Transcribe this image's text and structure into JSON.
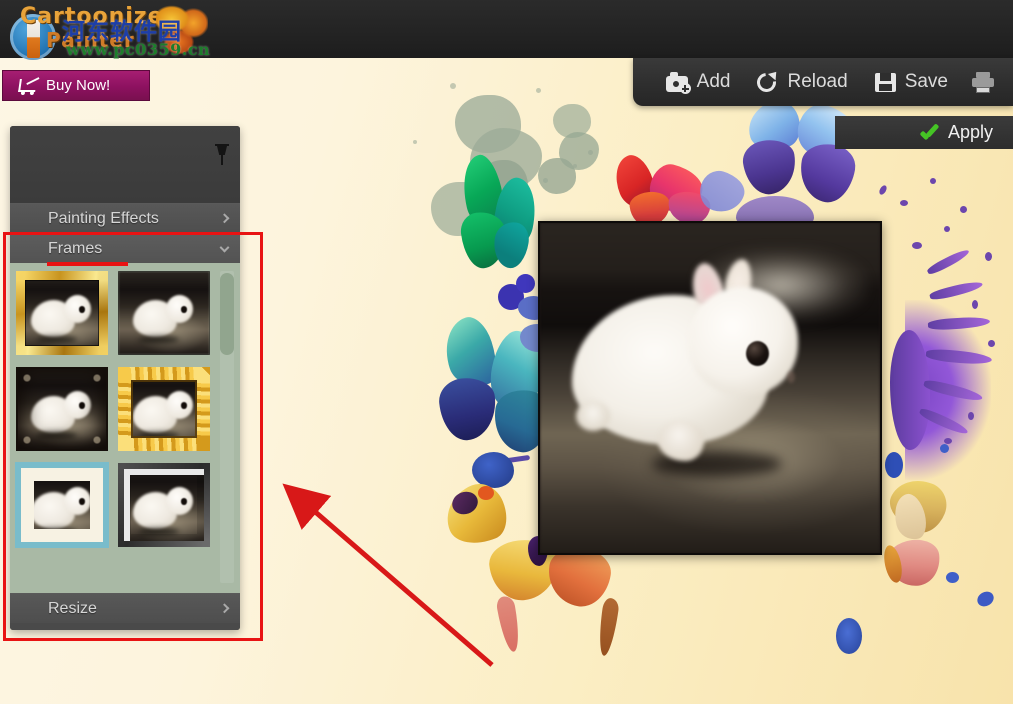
{
  "app": {
    "logo_top": "Cartoonize",
    "logo_bottom": "Painter",
    "watermark_text": "河东软件园",
    "watermark_url": "www.pc0359.cn",
    "accent_buy": "#8d1160",
    "accent_apply_check": "#45c425",
    "annotation_color": "#e81313",
    "canvas_background": "#faf0d2"
  },
  "buy": {
    "label": "Buy Now!",
    "icon": "shopping-cart-icon"
  },
  "toolbar": {
    "items": [
      {
        "label": "Add",
        "icon": "camera-add-icon"
      },
      {
        "label": "Reload",
        "icon": "circular-arrow-icon"
      },
      {
        "label": "Save",
        "icon": "floppy-disk-icon"
      },
      {
        "label": "",
        "icon": "printer-icon"
      }
    ]
  },
  "apply": {
    "label": "Apply",
    "icon": "green-check-icon"
  },
  "panel": {
    "pin_icon": "pushpin-icon",
    "sections": [
      {
        "label": "Painting Effects",
        "expanded": false,
        "chevron": "chevron-right-icon"
      },
      {
        "label": "Frames",
        "expanded": true,
        "chevron": "chevron-down-icon"
      },
      {
        "label": "Resize",
        "expanded": false,
        "chevron": "chevron-right-icon"
      }
    ],
    "frames": [
      {
        "name": "gold-bevel-frame",
        "style": "fr-gold",
        "selected": false
      },
      {
        "name": "no-frame",
        "style": "fr-plain",
        "selected": false
      },
      {
        "name": "ornate-vignette-frame",
        "style": "fr-orn",
        "selected": false
      },
      {
        "name": "baroque-gold-frame",
        "style": "fr-baroque",
        "selected": false
      },
      {
        "name": "teal-mat-frame",
        "style": "fr-mat",
        "selected": true
      },
      {
        "name": "grey-shadowbox-frame",
        "style": "fr-shadowbox",
        "selected": false
      }
    ]
  },
  "photo": {
    "subject": "white-baby-bunny-photo",
    "frame_border": "#0d0b0a"
  },
  "artwork": {
    "description": "watercolor butterflies and paint splatters on cream background",
    "butterflies": [
      "green",
      "red-pink",
      "blue-violet",
      "teal-blue",
      "yellow-orange",
      "peach-yellow"
    ],
    "splatter_colors": [
      "#96a694",
      "#6c46ad",
      "#3a3fc0",
      "#2f7fd6"
    ]
  }
}
